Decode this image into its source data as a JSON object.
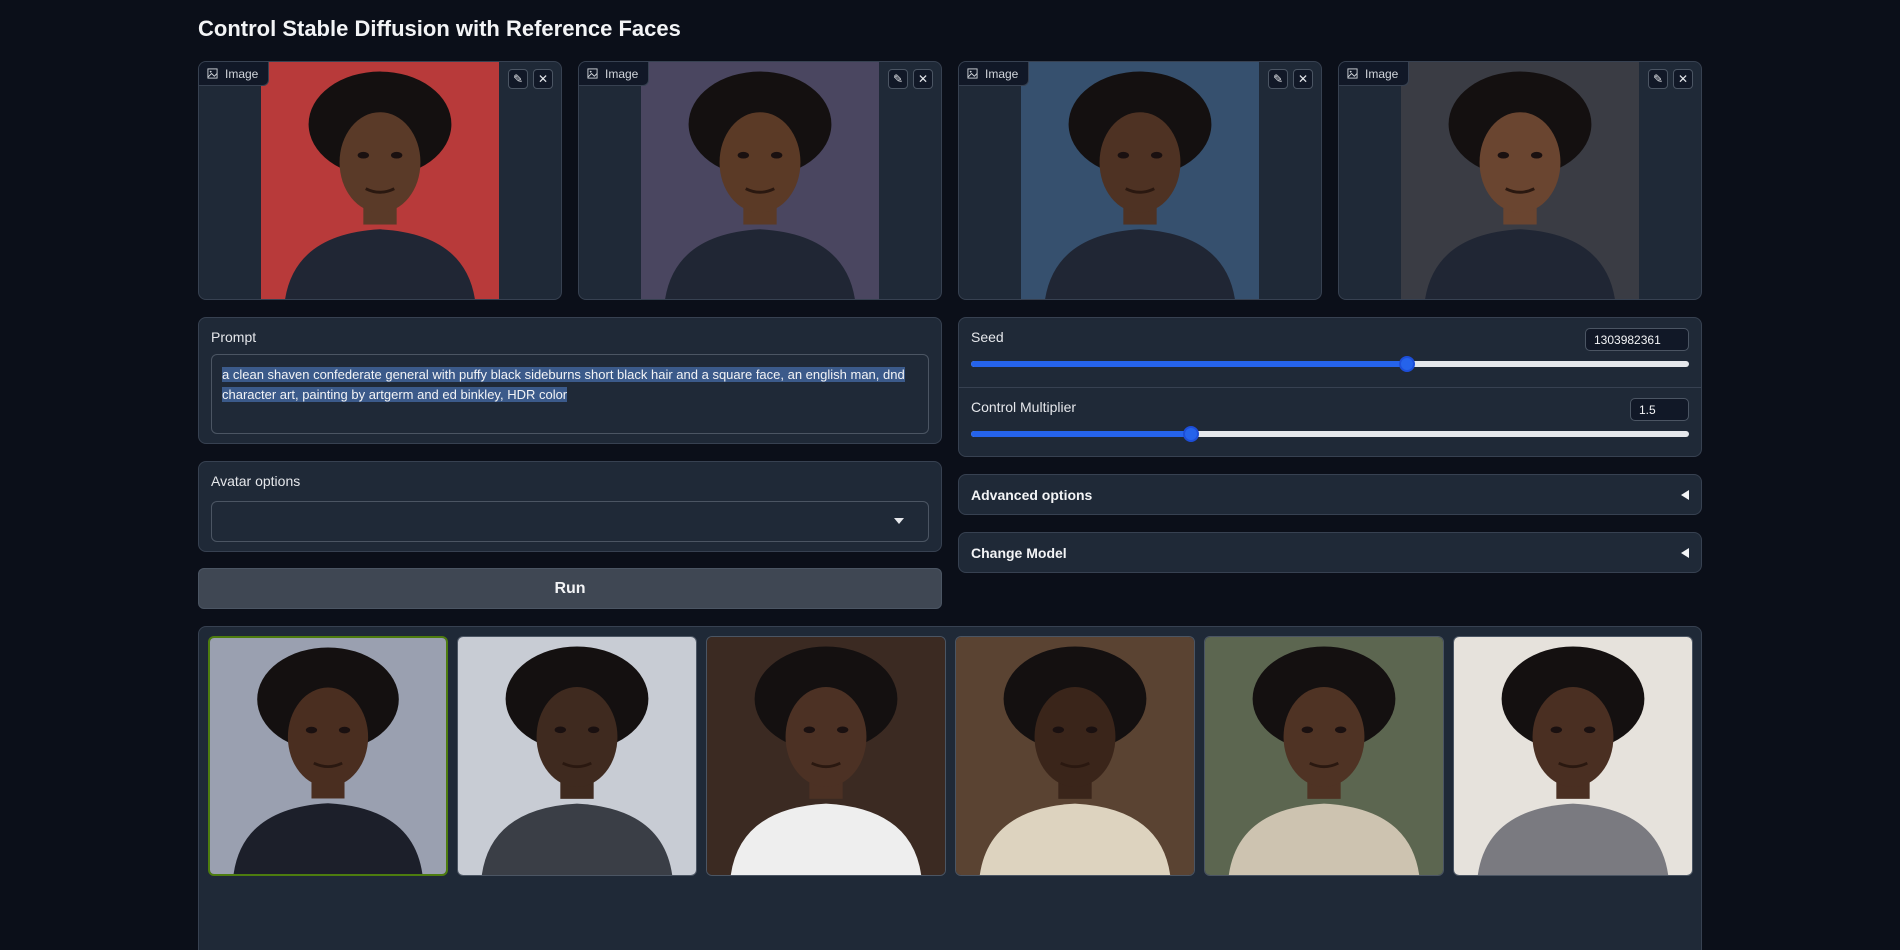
{
  "app": {
    "title": "Control Stable Diffusion with Reference Faces"
  },
  "image_inputs": [
    {
      "label": "Image",
      "bg": "#b83a3a",
      "skin": "#5a3a28"
    },
    {
      "label": "Image",
      "bg": "#4a4660",
      "skin": "#5b3a26"
    },
    {
      "label": "Image",
      "bg": "#36506e",
      "skin": "#4e3223"
    },
    {
      "label": "Image",
      "bg": "#3a3c44",
      "skin": "#6a4530"
    }
  ],
  "prompt": {
    "label": "Prompt",
    "line1": "a clean shaven confederate general with puffy black sideburns short black hair and a square face, an english man, dnd",
    "line2": "character art, painting by artgerm and ed binkley, HDR color"
  },
  "avatar": {
    "label": "Avatar options",
    "value": ""
  },
  "run": {
    "label": "Run"
  },
  "seed": {
    "label": "Seed",
    "value": "1303982361",
    "fraction": 0.607
  },
  "control": {
    "label": "Control Multiplier",
    "value": "1.5",
    "fraction": 0.306
  },
  "advanced": {
    "label": "Advanced options"
  },
  "change_model": {
    "label": "Change Model"
  },
  "gallery": [
    {
      "bg": "#9aa0b0",
      "coat": "#1c1f2a",
      "selected": true
    },
    {
      "bg": "#c8ccd4",
      "coat": "#3a3e46",
      "selected": false
    },
    {
      "bg": "#3b2a22",
      "coat": "#eeeeee",
      "selected": false
    },
    {
      "bg": "#5a4332",
      "coat": "#ddd3bf",
      "selected": false
    },
    {
      "bg": "#5c6650",
      "coat": "#cdc3b0",
      "selected": false
    },
    {
      "bg": "#e6e2dc",
      "coat": "#7a7a80",
      "selected": false
    }
  ],
  "icons": {
    "image": "image-icon",
    "edit": "pencil-icon",
    "close": "close-icon",
    "dropdown": "chevron-down-icon",
    "collapse": "triangle-left-icon"
  }
}
